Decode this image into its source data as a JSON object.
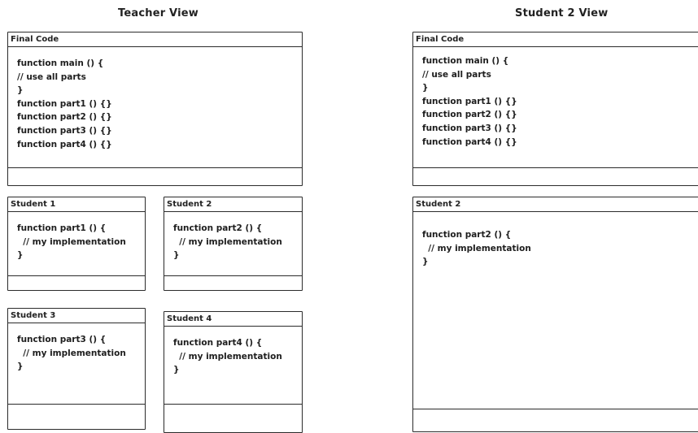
{
  "teacher_view": {
    "title": "Teacher View",
    "final_code": {
      "header": "Final Code",
      "lines": [
        "function main () {",
        "// use all parts",
        "}",
        "function part1 () {}",
        "function part2 () {}",
        "function part3 () {}",
        "function part4 () {}"
      ]
    },
    "students": [
      {
        "header": "Student 1",
        "lines": [
          "function part1 () {",
          "  // my implementation",
          "}"
        ]
      },
      {
        "header": "Student 2",
        "lines": [
          "function part2 () {",
          "  // my implementation",
          "}"
        ]
      },
      {
        "header": "Student 3",
        "lines": [
          "function part3 () {",
          "  // my implementation",
          "}"
        ]
      },
      {
        "header": "Student 4",
        "lines": [
          "function part4 () {",
          "  // my implementation",
          "}"
        ]
      }
    ]
  },
  "student2_view": {
    "title": "Student 2 View",
    "final_code": {
      "header": "Final Code",
      "lines": [
        "function main () {",
        "// use all parts",
        "}",
        "function part1 () {}",
        "function part2 () {}",
        "function part3 () {}",
        "function part4 () {}"
      ]
    },
    "student": {
      "header": "Student 2",
      "lines": [
        "function part2 () {",
        "  // my implementation",
        "}"
      ]
    }
  }
}
